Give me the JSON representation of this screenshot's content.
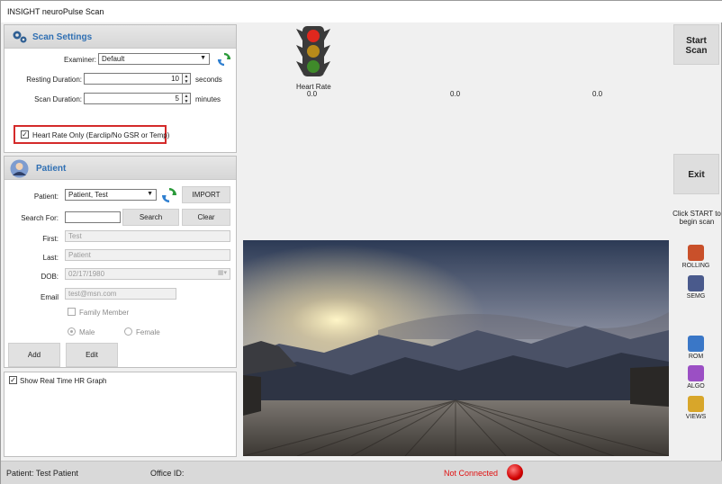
{
  "window": {
    "title": "INSIGHT neuroPulse Scan"
  },
  "scan_settings": {
    "title": "Scan Settings",
    "examiner_label": "Examiner:",
    "examiner_value": "Default",
    "resting_label": "Resting Duration:",
    "resting_value": "10",
    "resting_unit": "seconds",
    "scan_label": "Scan Duration:",
    "scan_value": "5",
    "scan_unit": "minutes",
    "hr_only_label": "Heart Rate Only (Earclip/No GSR or Temp)",
    "hr_only_checked": true
  },
  "patient": {
    "title": "Patient",
    "patient_label": "Patient:",
    "patient_value": "Patient, Test",
    "import_label": "IMPORT",
    "search_label": "Search For:",
    "search_value": "",
    "search_button": "Search",
    "clear_button": "Clear",
    "first_label": "First:",
    "first_value": "Test",
    "last_label": "Last:",
    "last_value": "Patient",
    "dob_label": "DOB:",
    "dob_value": "02/17/1980",
    "email_label": "Email",
    "email_value": "test@msn.com",
    "family_member_label": "Family Member",
    "male_label": "Male",
    "female_label": "Female",
    "selected_gender": "Male",
    "add_button": "Add",
    "edit_button": "Edit"
  },
  "graph": {
    "show_hr_label": "Show Real Time HR Graph",
    "checked": true
  },
  "readouts": {
    "heart_rate_label": "Heart Rate",
    "values": [
      "0.0",
      "0.0",
      "0.0"
    ]
  },
  "right_panel": {
    "start_label": "Start Scan",
    "exit_label": "Exit",
    "instruction": "Click START to begin scan",
    "tools": [
      {
        "label": "ROLLING",
        "icon": "rolling-icon",
        "color": "#c9502a"
      },
      {
        "label": "SEMG",
        "icon": "semg-icon",
        "color": "#4a5a8c"
      },
      {
        "label": "ROM",
        "icon": "rom-icon",
        "color": "#3a77c7"
      },
      {
        "label": "ALGO",
        "icon": "algo-icon",
        "color": "#9b4fc4"
      },
      {
        "label": "VIEWS",
        "icon": "views-icon",
        "color": "#d8a62a"
      }
    ]
  },
  "status": {
    "patient": "Patient: Test Patient",
    "office": "Office ID:",
    "connection": "Not Connected",
    "connection_color": "#e01010"
  }
}
